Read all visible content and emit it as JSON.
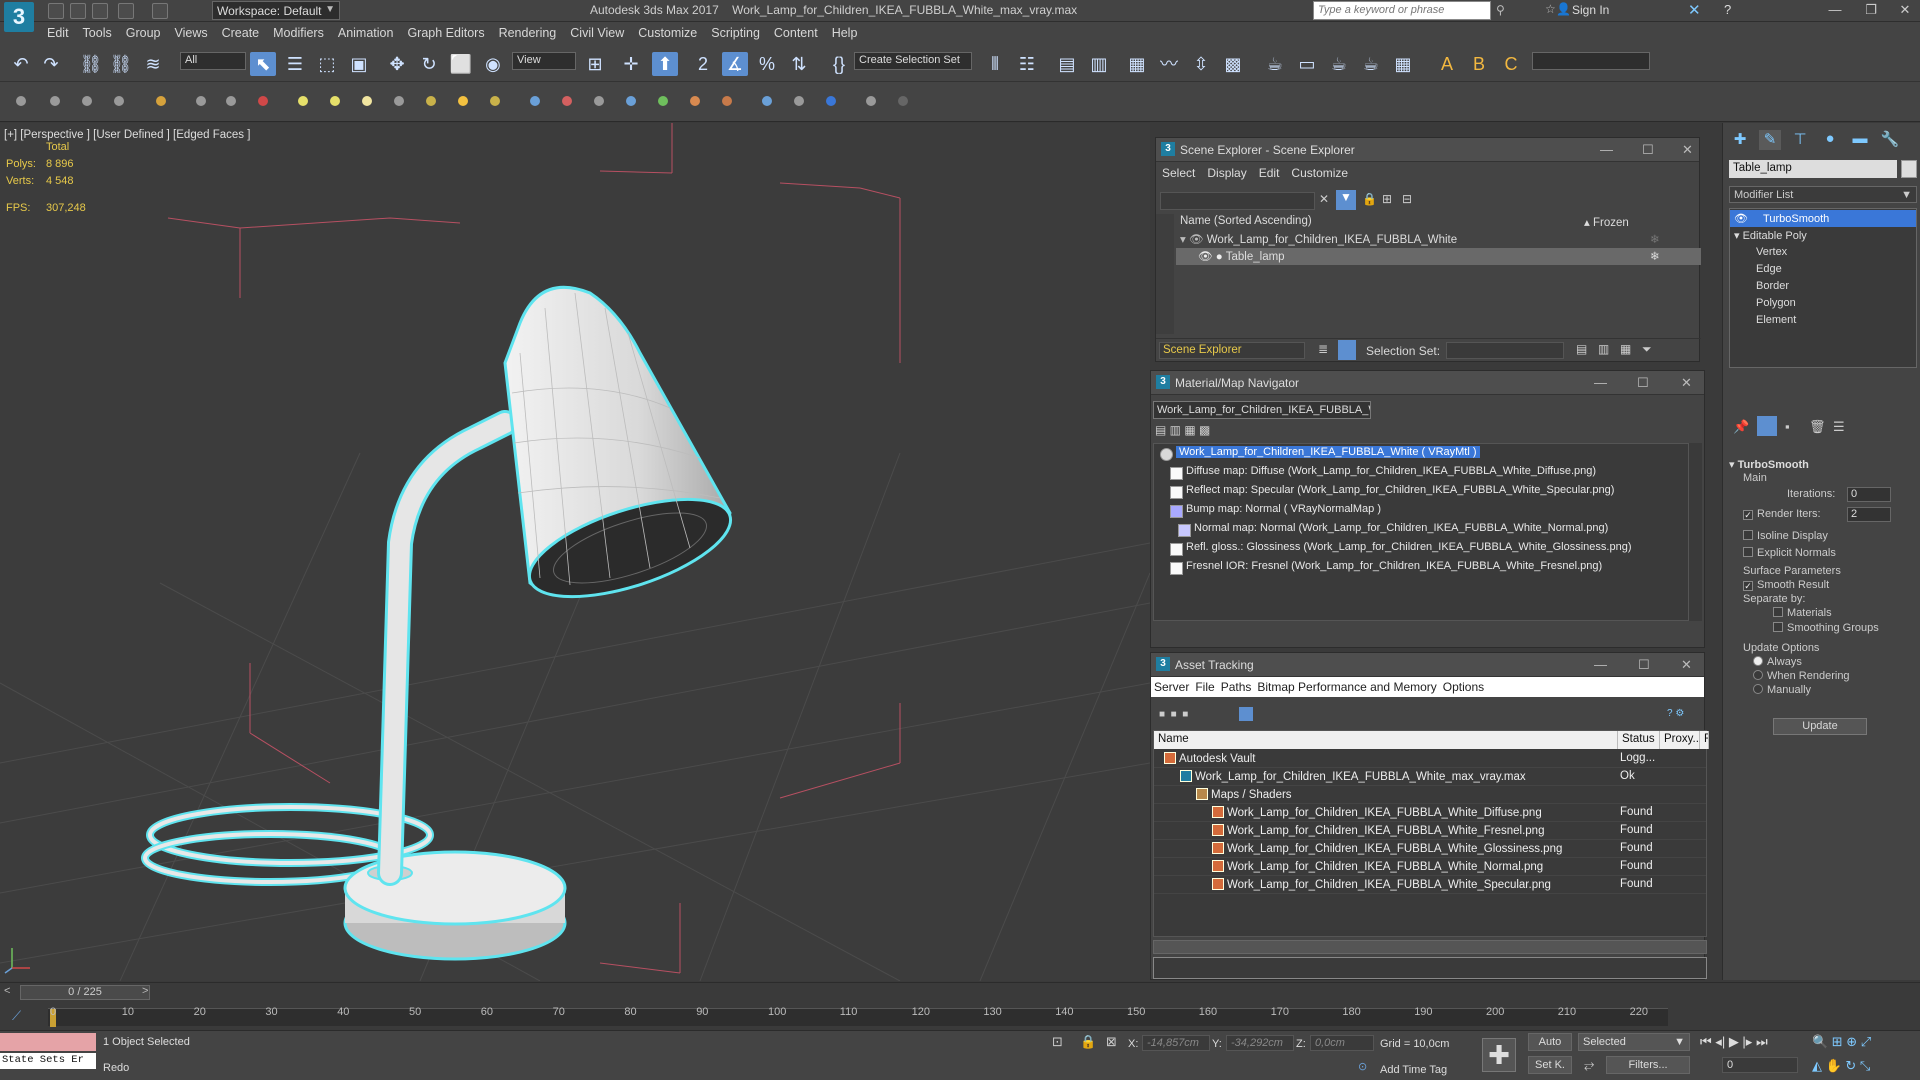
{
  "title_bar": {
    "workspace": "Workspace: Default",
    "app_title": "Autodesk 3ds Max 2017",
    "file_title": "Work_Lamp_for_Children_IKEA_FUBBLA_White_max_vray.max",
    "search_placeholder": "Type a keyword or phrase",
    "sign_in": "Sign In"
  },
  "menu": [
    "Edit",
    "Tools",
    "Group",
    "Views",
    "Create",
    "Modifiers",
    "Animation",
    "Graph Editors",
    "Rendering",
    "Civil View",
    "Customize",
    "Scripting",
    "Content",
    "Help"
  ],
  "toolbar": {
    "filter": "All",
    "ref_coord": "View",
    "selection_set": "Create Selection Set"
  },
  "viewport": {
    "label": "[+] [Perspective ] [User Defined ] [Edged Faces ]",
    "stats_header": "Total",
    "polys_label": "Polys:",
    "polys": "8 896",
    "verts_label": "Verts:",
    "verts": "4 548",
    "fps_label": "FPS:",
    "fps": "307,248"
  },
  "scene_explorer": {
    "title": "Scene Explorer - Scene Explorer",
    "menu": [
      "Select",
      "Display",
      "Edit",
      "Customize"
    ],
    "col_name": "Name (Sorted Ascending)",
    "col_frozen": "▴ Frozen",
    "rows": [
      "Work_Lamp_for_Children_IKEA_FUBBLA_White",
      "Table_lamp"
    ],
    "footer_name": "Scene Explorer",
    "selection_set_label": "Selection Set:"
  },
  "material_navigator": {
    "title": "Material/Map Navigator",
    "path": "Work_Lamp_for_Children_IKEA_FUBBLA_White",
    "root": "Work_Lamp_for_Children_IKEA_FUBBLA_White  ( VRayMtl )",
    "maps": [
      "Diffuse map: Diffuse (Work_Lamp_for_Children_IKEA_FUBBLA_White_Diffuse.png)",
      "Reflect map: Specular (Work_Lamp_for_Children_IKEA_FUBBLA_White_Specular.png)",
      "Bump map: Normal  ( VRayNormalMap )",
      "Normal map: Normal (Work_Lamp_for_Children_IKEA_FUBBLA_White_Normal.png)",
      "Refl. gloss.: Glossiness (Work_Lamp_for_Children_IKEA_FUBBLA_White_Glossiness.png)",
      "Fresnel IOR: Fresnel (Work_Lamp_for_Children_IKEA_FUBBLA_White_Fresnel.png)"
    ]
  },
  "asset_tracking": {
    "title": "Asset Tracking",
    "menu": [
      "Server",
      "File",
      "Paths",
      "Bitmap Performance and Memory",
      "Options"
    ],
    "cols": [
      "Name",
      "Status",
      "Proxy...",
      "R"
    ],
    "rows": [
      {
        "name": "Autodesk Vault",
        "status": "Logg...",
        "indent": 0
      },
      {
        "name": "Work_Lamp_for_Children_IKEA_FUBBLA_White_max_vray.max",
        "status": "Ok",
        "indent": 1
      },
      {
        "name": "Maps / Shaders",
        "status": "",
        "indent": 2
      },
      {
        "name": "Work_Lamp_for_Children_IKEA_FUBBLA_White_Diffuse.png",
        "status": "Found",
        "indent": 3
      },
      {
        "name": "Work_Lamp_for_Children_IKEA_FUBBLA_White_Fresnel.png",
        "status": "Found",
        "indent": 3
      },
      {
        "name": "Work_Lamp_for_Children_IKEA_FUBBLA_White_Glossiness.png",
        "status": "Found",
        "indent": 3
      },
      {
        "name": "Work_Lamp_for_Children_IKEA_FUBBLA_White_Normal.png",
        "status": "Found",
        "indent": 3
      },
      {
        "name": "Work_Lamp_for_Children_IKEA_FUBBLA_White_Specular.png",
        "status": "Found",
        "indent": 3
      }
    ]
  },
  "command_panel": {
    "object_name": "Table_lamp",
    "modifier_list": "Modifier List",
    "stack": [
      "TurboSmooth",
      "Editable Poly",
      "Vertex",
      "Edge",
      "Border",
      "Polygon",
      "Element"
    ],
    "turbosmooth": {
      "title": "TurboSmooth",
      "main": "Main",
      "iterations_label": "Iterations:",
      "iterations": "0",
      "render_iters_label": "Render Iters:",
      "render_iters": "2",
      "isoline": "Isoline Display",
      "explicit_normals": "Explicit Normals",
      "surface_params": "Surface Parameters",
      "smooth_result": "Smooth Result",
      "separate_by": "Separate by:",
      "materials": "Materials",
      "smoothing_groups": "Smoothing Groups",
      "update_options": "Update Options",
      "always": "Always",
      "when_rendering": "When Rendering",
      "manually": "Manually",
      "update": "Update"
    }
  },
  "timeline": {
    "frame": "0 / 225",
    "ticks": [
      "0",
      "10",
      "20",
      "30",
      "40",
      "50",
      "60",
      "70",
      "80",
      "90",
      "100",
      "110",
      "120",
      "130",
      "140",
      "150",
      "160",
      "170",
      "180",
      "190",
      "200",
      "210",
      "220"
    ]
  },
  "status": {
    "maxscript": "State Sets Er",
    "selected": "1 Object Selected",
    "last_action": "Redo",
    "x_label": "X:",
    "x": "-14,857cm",
    "y_label": "Y:",
    "y": "-34,292cm",
    "z_label": "Z:",
    "z": "0,0cm",
    "grid": "Grid = 10,0cm",
    "add_time_tag": "Add Time Tag",
    "auto": "Auto",
    "set_k": "Set K.",
    "selected_dd": "Selected",
    "filters": "Filters...",
    "frame_field": "0"
  },
  "colors": {
    "selection_accent": "#3a77d8",
    "wire_highlight": "#5fe4ef",
    "stat_text": "#e7c94a"
  }
}
